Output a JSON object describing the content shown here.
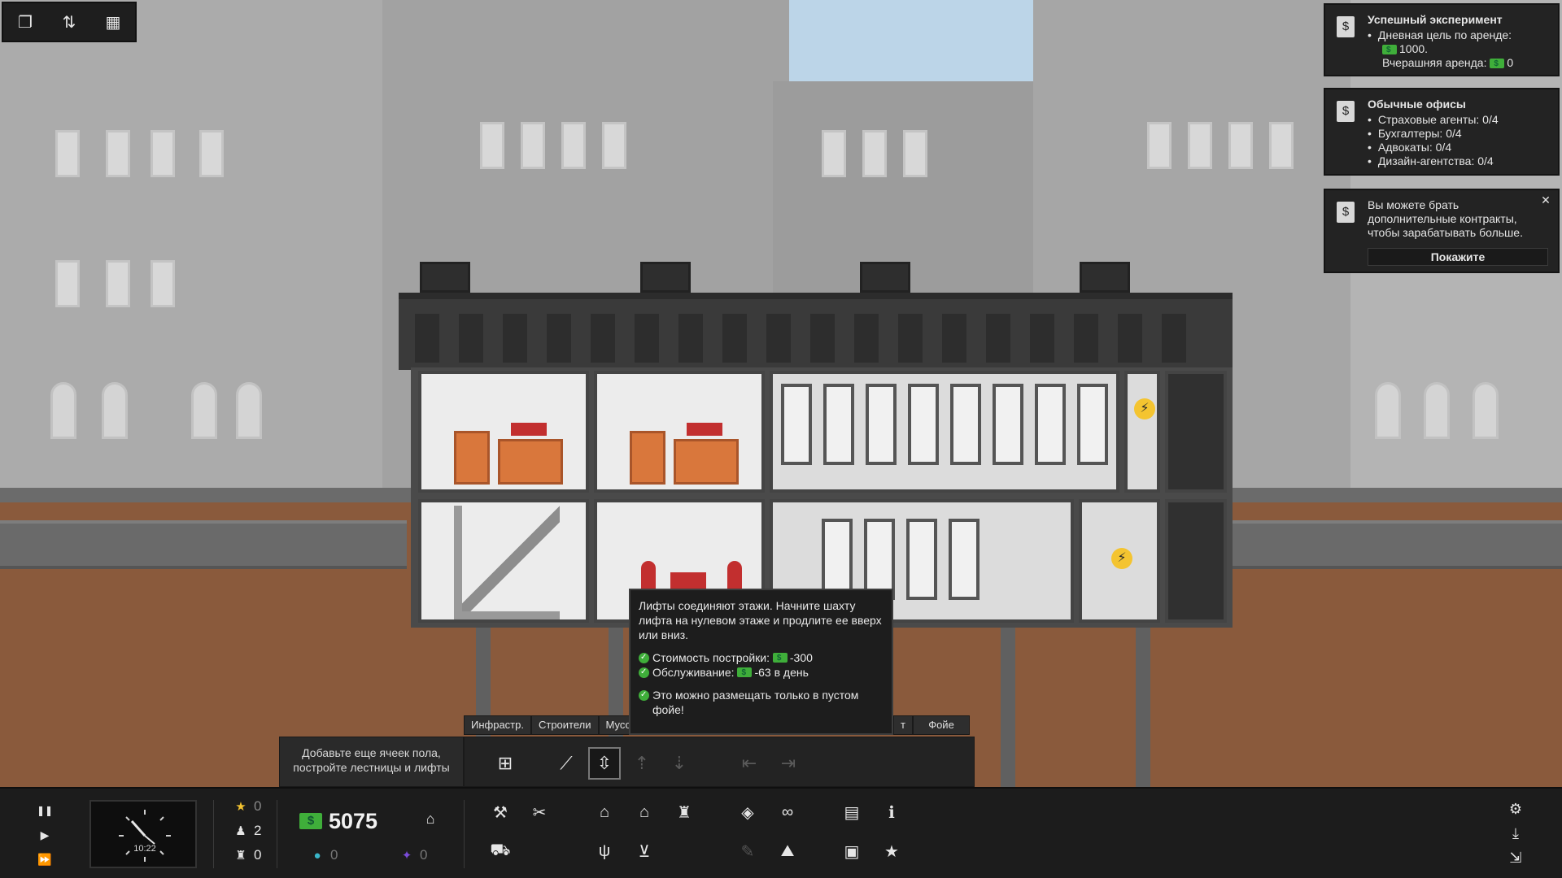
{
  "toolbar_tl": [
    {
      "name": "layers-icon",
      "glyph": "❐"
    },
    {
      "name": "stats-icon",
      "glyph": "⇅"
    },
    {
      "name": "list-icon",
      "glyph": "▦"
    }
  ],
  "notifications": [
    {
      "title": "Успешный эксперимент",
      "items": [
        "Дневная цель по аренде:"
      ],
      "goal_value": "1000.",
      "yesterday_label": "Вчерашняя аренда:",
      "yesterday_value": "0"
    },
    {
      "title": "Обычные офисы",
      "items": [
        "Страховые агенты: 0/4",
        "Бухгалтеры: 0/4",
        "Адвокаты: 0/4",
        "Дизайн-агентства: 0/4"
      ]
    },
    {
      "text": "Вы можете брать дополнительные контракты, чтобы зарабатывать больше.",
      "action": "Покажите",
      "close": "✕"
    }
  ],
  "tooltip": {
    "desc": "Лифты соединяют этажи. Начните шахту лифта на нулевом этаже и продлите ее вверх или вниз.",
    "cost_label": "Стоимость постройки:",
    "cost_value": "-300",
    "upkeep_label": "Обслуживание:",
    "upkeep_value": "-63 в день",
    "note": "Это можно размещать только в пустом фойе!"
  },
  "build_panel": {
    "tabs": [
      "Инфрастр.",
      "Строители",
      "Мусо"
    ],
    "tab_right_1": "т",
    "tab_right_2": "Фойе",
    "hint": "Добавьте еще ячеек пола, постройте лестницы и лифты",
    "tools": [
      {
        "name": "add-floor-icon",
        "glyph": "⊞",
        "state": "normal"
      },
      {
        "name": "stairs-icon",
        "glyph": "⟋",
        "state": "normal"
      },
      {
        "name": "elevator-icon",
        "glyph": "⇳",
        "state": "selected"
      },
      {
        "name": "elevator-up-icon",
        "glyph": "⇡",
        "state": "disabled"
      },
      {
        "name": "elevator-down-icon",
        "glyph": "⇣",
        "state": "disabled"
      },
      {
        "name": "expand-left-icon",
        "glyph": "⇤",
        "state": "disabled"
      },
      {
        "name": "expand-right-icon",
        "glyph": "⇥",
        "state": "disabled"
      }
    ]
  },
  "hud": {
    "speed_controls": [
      {
        "name": "pause-icon",
        "glyph": "❚❚"
      },
      {
        "name": "play-icon",
        "glyph": "▶"
      },
      {
        "name": "fast-forward-icon",
        "glyph": "⏩"
      }
    ],
    "time": "10:22",
    "stars": "0",
    "workers": "2",
    "tenants": "0",
    "money": "5075",
    "influence": "0",
    "prestige": "0",
    "actions": [
      {
        "name": "build-hammer-icon",
        "glyph": "⚒"
      },
      {
        "name": "tools-icon",
        "glyph": "✂"
      },
      {
        "name": "bulldozer-icon",
        "glyph": "⛟"
      },
      {
        "name": "office-desk-icon",
        "glyph": "⌂"
      },
      {
        "name": "house-icon",
        "glyph": "⌂"
      },
      {
        "name": "city-icon",
        "glyph": "♜"
      },
      {
        "name": "fork-knife-icon",
        "glyph": "ψ"
      },
      {
        "name": "cart-icon",
        "glyph": "⊻"
      },
      {
        "name": "box-icon",
        "glyph": "◈"
      },
      {
        "name": "handshake-icon",
        "glyph": "∞"
      },
      {
        "name": "brush-icon",
        "glyph": "✎"
      },
      {
        "name": "landscape-icon",
        "glyph": "⛰"
      },
      {
        "name": "contracts-icon",
        "glyph": "▤"
      },
      {
        "name": "info-desk-icon",
        "glyph": "ℹ"
      },
      {
        "name": "reports-icon",
        "glyph": "▣"
      },
      {
        "name": "special-star-icon",
        "glyph": "★"
      }
    ],
    "system": [
      {
        "name": "settings-gear-icon",
        "glyph": "⚙"
      },
      {
        "name": "save-download-icon",
        "glyph": "⤓"
      },
      {
        "name": "exit-door-icon",
        "glyph": "⇲"
      }
    ]
  }
}
